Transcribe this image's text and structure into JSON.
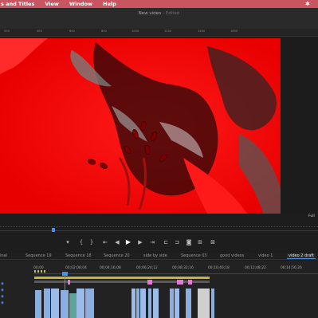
{
  "menubar": {
    "items": [
      "s and Titles",
      "View",
      "Window",
      "Help"
    ],
    "bg": "#c8555f"
  },
  "window": {
    "title": "New video",
    "title_suffix": " - Edited"
  },
  "ruler": {
    "ticks": [
      "200",
      "400",
      "600",
      "800",
      "1000",
      "1200",
      "1400",
      "1600"
    ]
  },
  "canvas": {
    "zoom_label": "Full"
  },
  "sequence_tabs": [
    {
      "label": "inal",
      "active": false
    },
    {
      "label": "Sequence 19",
      "active": false
    },
    {
      "label": "Sequence 18",
      "active": false
    },
    {
      "label": "Sequence 20",
      "active": false
    },
    {
      "label": "side by side",
      "active": false
    },
    {
      "label": "Sequence 03",
      "active": false
    },
    {
      "label": "good videos",
      "active": false
    },
    {
      "label": "video 1",
      "active": false
    },
    {
      "label": "video 2 draft",
      "active": true,
      "close": "×"
    }
  ],
  "timeline": {
    "timecodes": [
      "00;00",
      "00;02;08;04",
      "00;04;16;08",
      "00;06;24;12",
      "00;08;32;16",
      "00;10;40;18",
      "00;12;48;22",
      "00;14;56;26"
    ],
    "colors": {
      "yellow": "#c8b43a",
      "pink": "#e27ad4",
      "blue": "#8aaee0",
      "teal": "#5fa39a",
      "playhead": "#4a8fe0"
    }
  }
}
